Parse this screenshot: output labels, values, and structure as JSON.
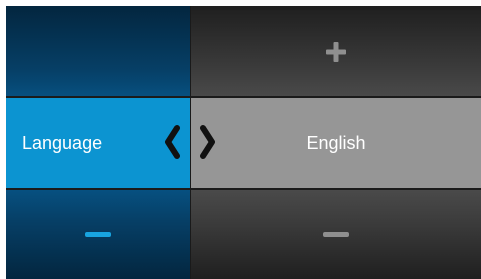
{
  "setting": {
    "label": "Language",
    "value": "English"
  },
  "icons": {
    "increase": "plus-icon",
    "decrease_left": "minus-icon",
    "decrease_right": "minus-icon",
    "previous": "chevron-left-icon",
    "next": "chevron-right-icon"
  },
  "colors": {
    "accent_blue": "#0c94d1",
    "dark_blue": "#063f66",
    "value_gray": "#969696",
    "dark_gray": "#3a3a3a",
    "icon_gray": "#8f8f8f",
    "minus_blue": "#18a4e0"
  }
}
